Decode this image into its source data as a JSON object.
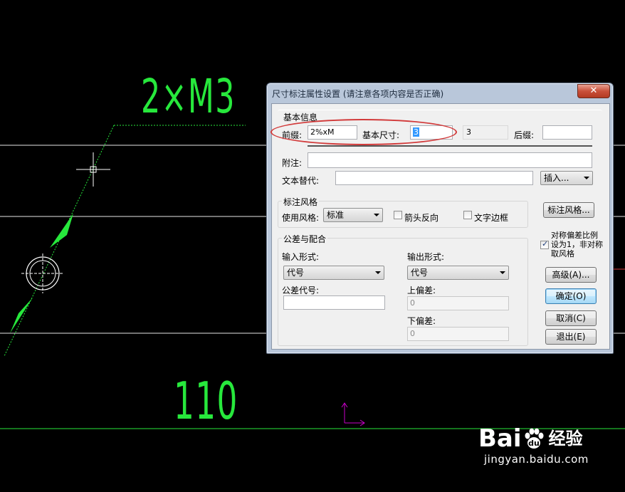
{
  "drawing": {
    "dim_text_top": "2×M3",
    "dim_text_bottom": "110"
  },
  "dialog": {
    "title": "尺寸标注属性设置 (请注意各项内容是否正确)",
    "close_glyph": "✕",
    "basic_info": {
      "group_label": "基本信息",
      "prefix_label": "前缀:",
      "prefix_value": "2%xM",
      "base_size_label": "基本尺寸:",
      "base_size_value": "3",
      "base_size_display": "3",
      "suffix_label": "后缀:",
      "suffix_value": "",
      "note_label": "附注:",
      "note_value": "",
      "text_replace_label": "文本替代:",
      "text_replace_value": "",
      "insert_label": "插入..."
    },
    "style": {
      "group_label": "标注风格",
      "use_style_label": "使用风格:",
      "use_style_value": "标准",
      "arrow_reverse_label": "箭头反向",
      "arrow_reverse_checked": false,
      "text_border_label": "文字边框",
      "text_border_checked": false,
      "style_button": "标注风格..."
    },
    "symmetric": {
      "label": "对称偏差比例设为1，非对称取风格",
      "checked": true
    },
    "tolerance": {
      "group_label": "公差与配合",
      "input_form_label": "输入形式:",
      "input_form_value": "代号",
      "output_form_label": "输出形式:",
      "output_form_value": "代号",
      "tol_code_label": "公差代号:",
      "tol_code_value": "",
      "upper_label": "上偏差:",
      "upper_value": "0",
      "lower_label": "下偏差:",
      "lower_value": "0"
    },
    "buttons": {
      "advanced": "高级(A)...",
      "ok": "确定(O)",
      "cancel": "取消(C)",
      "exit": "退出(E)"
    }
  },
  "watermark": {
    "logo_text": "Bai",
    "logo_text_2": "du",
    "cn_text": "经验",
    "url": "jingyan.baidu.com"
  },
  "colors": {
    "cad_background": "#000000",
    "cad_lines": "#ffffff",
    "cad_dimension": "#27e83c",
    "ucs_icon": "#c800c8",
    "annotation_ellipse": "#d23a3a",
    "dialog_frame": "#b9c7da"
  }
}
